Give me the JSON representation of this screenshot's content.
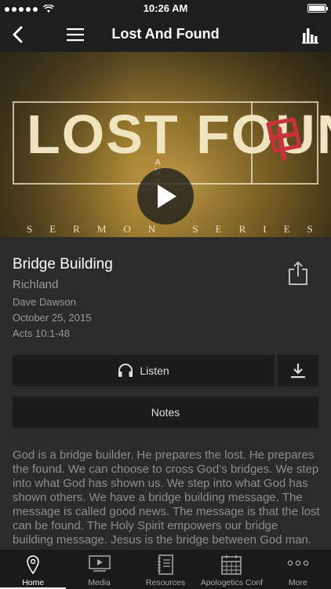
{
  "status_bar": {
    "time": "10:26 AM",
    "signal_icon": "signal-dots",
    "wifi_icon": "wifi-icon",
    "battery_icon": "battery-icon"
  },
  "nav": {
    "title": "Lost And Found",
    "back_icon": "back-chevron-icon",
    "menu_icon": "hamburger-icon",
    "chart_icon": "bar-chart-icon"
  },
  "hero": {
    "title": "LOST  FOUND",
    "and": "A N D",
    "subtitle": "SERMON SERIES",
    "play_icon": "play-icon",
    "logo_icon": "church-logo-icon"
  },
  "sermon": {
    "title": "Bridge Building",
    "series": "Richland",
    "speaker": "Dave Dawson",
    "date": "October 25, 2015",
    "passage": "Acts 10:1-48",
    "share_icon": "share-icon"
  },
  "actions": {
    "listen_label": "Listen",
    "listen_icon": "headphones-icon",
    "download_icon": "download-icon",
    "notes_label": "Notes"
  },
  "description": "God is a bridge builder. He prepares the lost. He prepares the found. We can choose to cross God’s bridges. We step into what God has shown us. We step into what God has shown others. We have a bridge building message. The message is called good news. The message is that the lost can be found. The Holy Spirit empowers our bridge building message. Jesus is the bridge between God man.",
  "tabs": [
    {
      "label": "Home",
      "icon": "location-pin-icon",
      "active": true
    },
    {
      "label": "Media",
      "icon": "media-icon",
      "active": false
    },
    {
      "label": "Resources",
      "icon": "notebook-icon",
      "active": false
    },
    {
      "label": "Apologetics Conf",
      "icon": "calendar-icon",
      "active": false
    },
    {
      "label": "More",
      "icon": "more-dots-icon",
      "active": false
    }
  ],
  "colors": {
    "background": "#2b2b2b",
    "bar": "#1e1e1e",
    "button": "#1c1c1c",
    "muted_text": "#9a9a9a",
    "logo_red": "#c8323a"
  }
}
